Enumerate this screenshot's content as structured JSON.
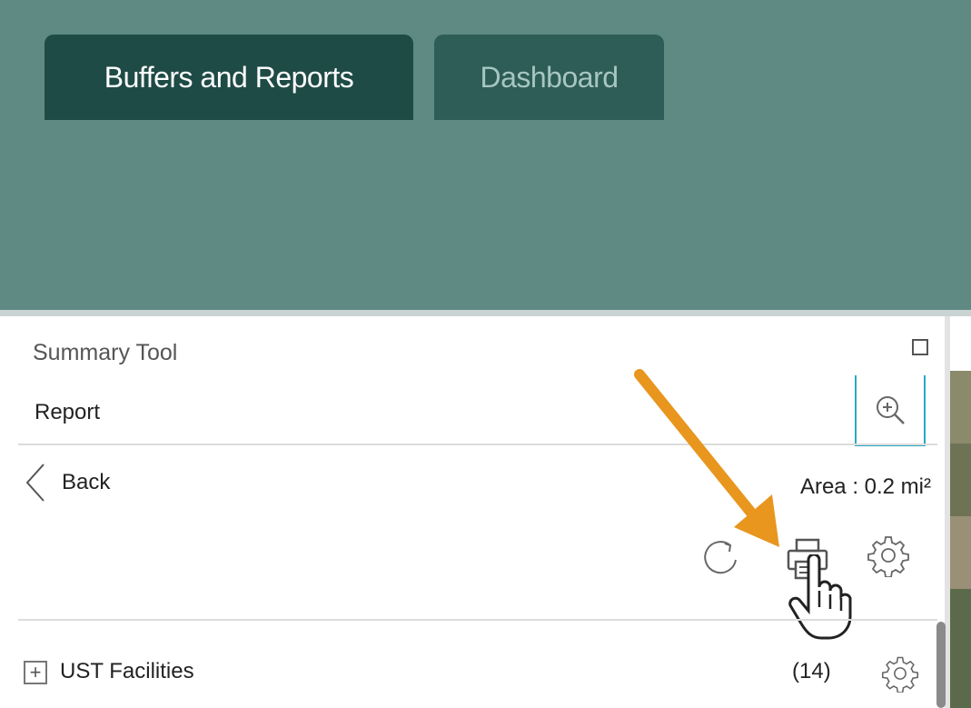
{
  "tabs": [
    {
      "label": "Buffers and Reports",
      "active": true
    },
    {
      "label": "Dashboard",
      "active": false
    }
  ],
  "panel": {
    "title": "Summary Tool",
    "subtitle": "Report",
    "back_label": "Back",
    "area_text": "Area : 0.2 mi²"
  },
  "toolbar": {
    "icons": [
      "refresh-icon",
      "print-icon",
      "settings-icon"
    ]
  },
  "layers": [
    {
      "expand_symbol": "+",
      "name": "UST Facilities",
      "count": "(14)"
    }
  ],
  "colors": {
    "header_bg": "#5f8a84",
    "tab_active_bg": "#1f4b46",
    "tab_inactive_bg": "#2e5c57",
    "accent": "#2aa7c4",
    "annotation_arrow": "#e8961e"
  }
}
